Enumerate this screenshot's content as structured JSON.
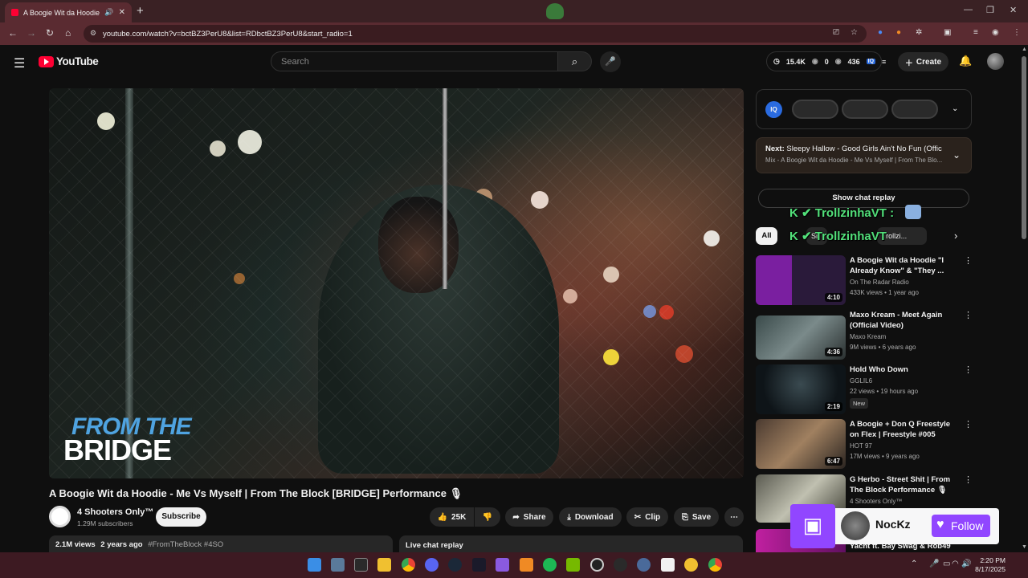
{
  "browser": {
    "tab_title": "A Boogie Wit da Hoodie - M",
    "new_tab": "+",
    "url": "youtube.com/watch?v=bctBZ3PerU8&list=RDbctBZ3PerU8&start_radio=1"
  },
  "header": {
    "logo_text": "YouTube",
    "search_placeholder": "Search",
    "stats": {
      "views": "15.4K",
      "zero": "0",
      "other": "436"
    },
    "create_label": "Create"
  },
  "video": {
    "brand_line1": "FROM THE",
    "brand_line2": "BRIDGE",
    "title": "A Boogie Wit da Hoodie - Me Vs Myself | From The Block [BRIDGE] Performance 🎙",
    "channel": "4 Shooters Only™",
    "subscribers": "1.29M subscribers",
    "subscribe_label": "Subscribe",
    "likes": "25K",
    "share_label": "Share",
    "download_label": "Download",
    "clip_label": "Clip",
    "save_label": "Save",
    "views": "2.1M views",
    "age": "2 years ago",
    "hashtags": "#FromTheBlock #4SO",
    "live_chat_label": "Live chat replay"
  },
  "sidebar": {
    "iq_label": "IQ",
    "next_title_prefix": "Next:",
    "next_title": "Sleepy Hallow - Good Girls Ain't No Fun (Offici...",
    "next_sub": "Mix - A Boogie Wit da Hoodie - Me Vs Myself | From The Blo...",
    "show_chat_replay": "Show chat replay",
    "overlay_user": "TrollzinhaVT",
    "overlay_user_2": "TrollzinhaVT",
    "chip_all": "All",
    "chip_2": "Si",
    "chip_3": "Trollzi...",
    "recommendations": [
      {
        "title": "A Boogie Wit da Hoodie \"I Already Know\" & \"They ...",
        "channel": "On The Radar Radio",
        "meta": "433K views • 1 year ago",
        "duration": "4:10",
        "badge": ""
      },
      {
        "title": "Maxo Kream - Meet Again (Official Video)",
        "channel": "Maxo Kream",
        "meta": "9M views • 6 years ago",
        "duration": "4:36",
        "badge": ""
      },
      {
        "title": "Hold Who Down",
        "channel": "GGLIL6",
        "meta": "22 views • 19 hours ago",
        "duration": "2:19",
        "badge": "New"
      },
      {
        "title": "A Boogie + Don Q Freestyle on Flex | Freestyle #005",
        "channel": "HOT 97",
        "meta": "17M views • 9 years ago",
        "duration": "6:47",
        "badge": ""
      },
      {
        "title": "G Herbo - Street Shit | From The Block Performance 🎙",
        "channel": "4 Shooters Only™",
        "meta": "",
        "duration": "",
        "badge": ""
      },
      {
        "title": "Yacht ft. Bay Swag & Rob49 ...",
        "channel": "",
        "meta": "",
        "duration": "",
        "badge": ""
      }
    ]
  },
  "twitch": {
    "name": "NocKz",
    "follow_label": "Follow"
  },
  "taskbar": {
    "time": "2:20 PM",
    "date": "8/17/2025"
  }
}
